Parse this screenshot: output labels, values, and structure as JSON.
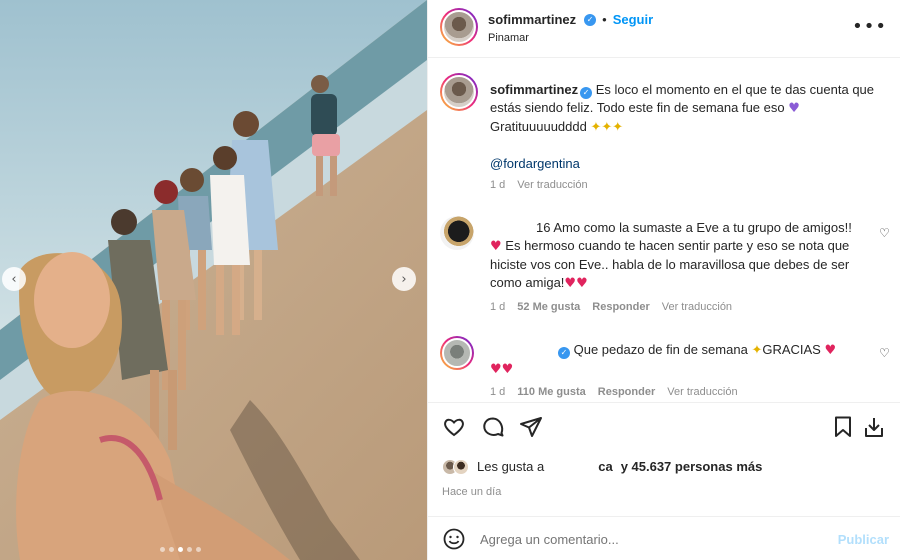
{
  "header": {
    "username": "sofimmartinez",
    "follow_label": "Seguir",
    "location": "Pinamar",
    "more_icon": "more-horizontal-icon"
  },
  "caption": {
    "username": "sofimmartinez",
    "text": "Es loco el momento en el que te das cuenta que estás siendo feliz. Todo este fin de semana fue eso",
    "text_tail": "Gratituuuuudddd",
    "mention": "@fordargentina",
    "age": "1 d",
    "translate": "Ver traducción"
  },
  "comments": [
    {
      "prefix": "16",
      "line1": "Amo como la sumaste a Eve a tu grupo de amigos!!",
      "line2": "Es hermoso cuando te hacen sentir parte y eso se nota que",
      "line3": "hiciste vos con Eve.. habla de lo maravillosa que debes de ser",
      "line4": "como amiga!",
      "age": "1 d",
      "likes": "52 Me gusta",
      "reply": "Responder",
      "translate": "Ver traducción"
    },
    {
      "text": "Que pedazo de fin de semana",
      "text_tail": "GRACIAS",
      "age": "1 d",
      "likes": "110 Me gusta",
      "reply": "Responder",
      "translate": "Ver traducción"
    }
  ],
  "likes_summary": {
    "prefix": "Les gusta a",
    "middle": "ca",
    "suffix": "y 45.637 personas más",
    "time": "Hace un día"
  },
  "composer": {
    "placeholder": "Agrega un comentario...",
    "publish": "Publicar"
  },
  "carousel": {
    "slide_count": 5,
    "active_index": 2
  },
  "colors": {
    "link_blue": "#0095f6",
    "verified_blue": "#3897f0",
    "heart_red": "#e0245e",
    "mention_color": "#00376b",
    "muted_text": "#8e8e8e"
  }
}
